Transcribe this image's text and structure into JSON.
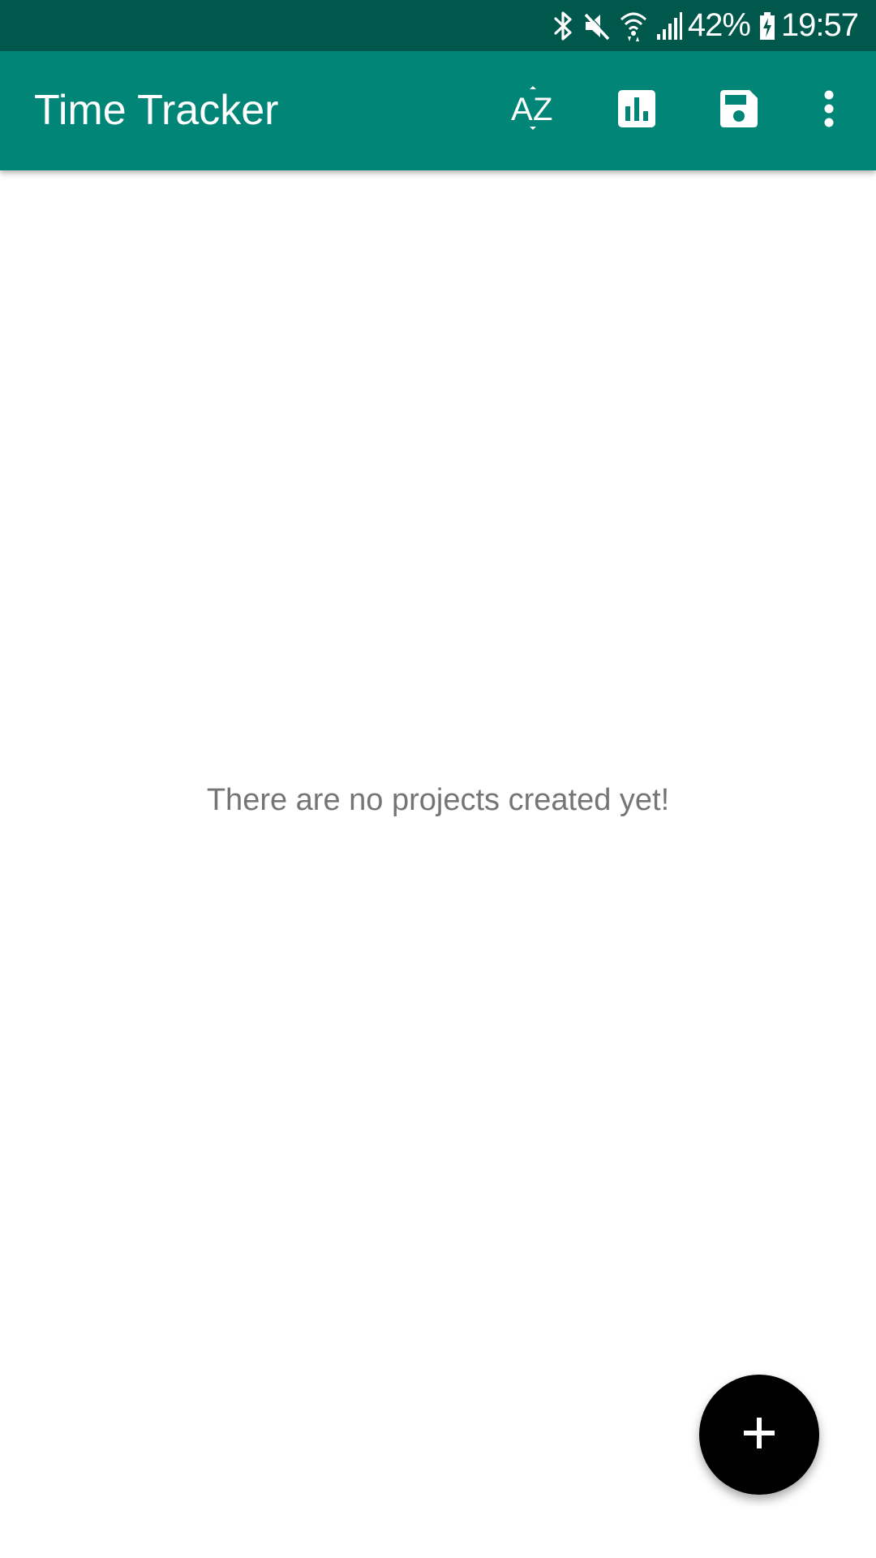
{
  "status_bar": {
    "battery": "42%",
    "time": "19:57",
    "icons": [
      "bluetooth-icon",
      "mute-icon",
      "wifi-icon",
      "signal-icon",
      "battery-charging-icon"
    ]
  },
  "app_bar": {
    "title": "Time Tracker",
    "actions": [
      {
        "name": "sort-az",
        "icon": "sort-az-icon"
      },
      {
        "name": "statistics",
        "icon": "bar-chart-icon"
      },
      {
        "name": "save",
        "icon": "save-icon"
      },
      {
        "name": "more-options",
        "icon": "more-vert-icon"
      }
    ]
  },
  "main": {
    "empty_message": "There are no projects created yet!"
  },
  "fab": {
    "icon": "add-icon"
  },
  "colors": {
    "status_bar": "#00574b",
    "app_bar": "#008577",
    "fab": "#000000",
    "empty_text": "#757575"
  }
}
